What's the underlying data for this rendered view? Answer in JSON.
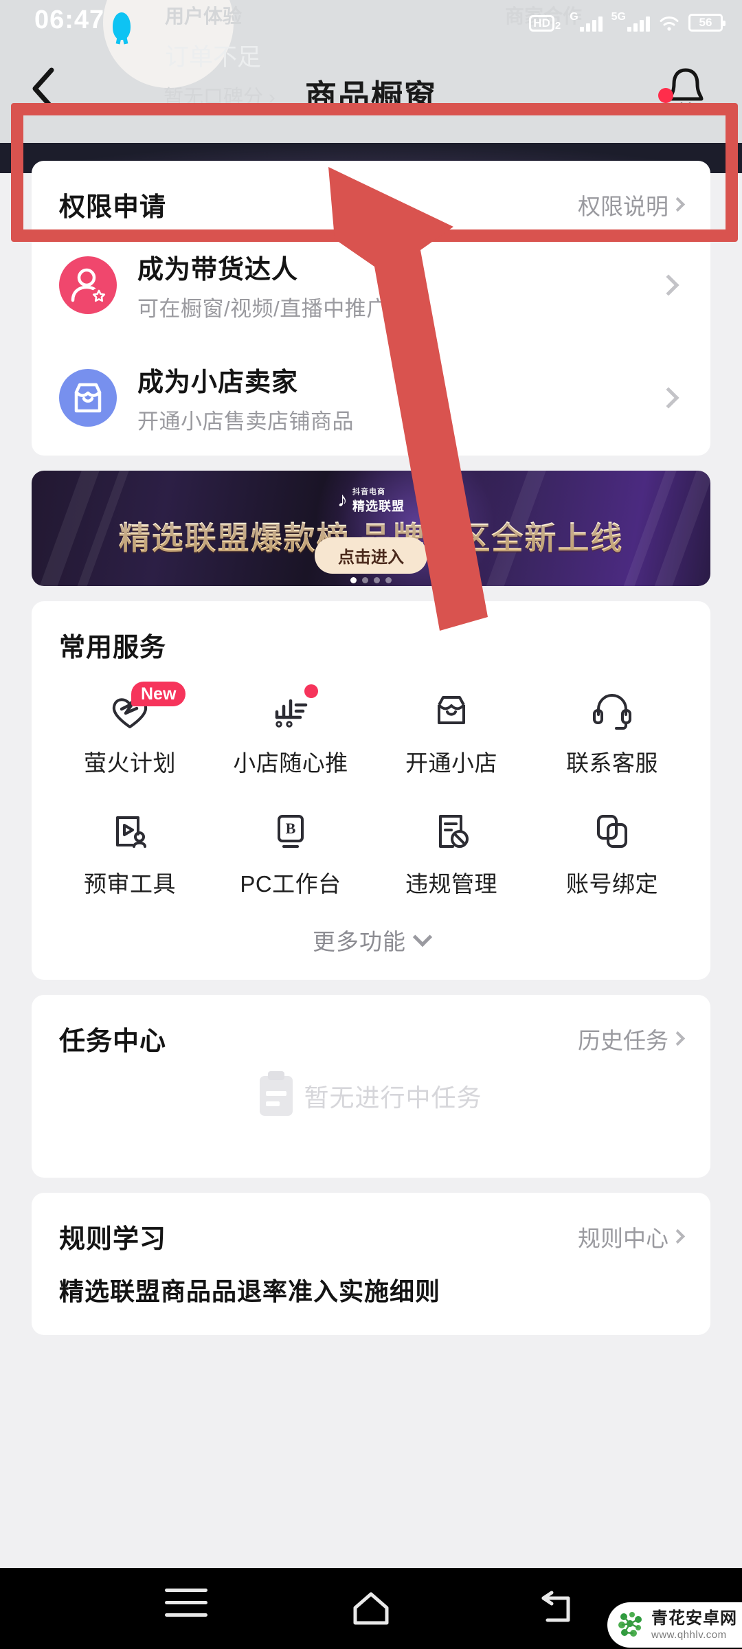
{
  "status_bar": {
    "time": "06:47",
    "hd_label": "HD",
    "hd_sub": "2",
    "net1_sup": "G",
    "net2_sup": "5G",
    "battery": "56",
    "icons": [
      "qq-icon",
      "hd-voice-icon",
      "signal-icon",
      "signal-5g-icon",
      "wifi-icon",
      "battery-icon"
    ]
  },
  "ghost_background": {
    "user_experience": "用户体验",
    "merchant_cooperation": "商家合作",
    "order_insufficient": "订单不足",
    "no_score": "暂无口碑分 ›"
  },
  "nav": {
    "title": "商品橱窗",
    "back_icon": "back-chevron-icon",
    "bell_icon": "bell-icon",
    "bell_has_dot": true
  },
  "permission_card": {
    "title": "权限申请",
    "link_label": "权限说明",
    "rows": [
      {
        "icon": "talent-person-star-icon",
        "icon_color": "#f0476d",
        "name": "成为带货达人",
        "desc": "可在橱窗/视频/直播中推广商品"
      },
      {
        "icon": "shop-store-icon",
        "icon_color": "#7790ee",
        "name": "成为小店卖家",
        "desc": "开通小店售卖店铺商品"
      }
    ]
  },
  "banner": {
    "logo_top": "抖音电商",
    "logo_bottom": "精选联盟",
    "title": "精选联盟爆款榜 品牌专区全新上线",
    "button": "点击进入",
    "dots": 4,
    "active_dot": 0
  },
  "services": {
    "title": "常用服务",
    "items": [
      {
        "label": "萤火计划",
        "icon": "firefly-heart-icon",
        "badge": "New"
      },
      {
        "label": "小店随心推",
        "icon": "promote-bars-icon",
        "dot": true
      },
      {
        "label": "开通小店",
        "icon": "open-shop-icon"
      },
      {
        "label": "联系客服",
        "icon": "headset-support-icon"
      },
      {
        "label": "预审工具",
        "icon": "preview-tool-icon"
      },
      {
        "label": "PC工作台",
        "icon": "pc-workbench-icon"
      },
      {
        "label": "违规管理",
        "icon": "violation-doc-icon"
      },
      {
        "label": "账号绑定",
        "icon": "account-link-icon"
      }
    ],
    "more_label": "更多功能",
    "more_icon": "chevron-down-icon"
  },
  "task_center": {
    "title": "任务中心",
    "link_label": "历史任务",
    "empty_text": "暂无进行中任务",
    "empty_icon": "clipboard-empty-icon"
  },
  "rules": {
    "title": "规则学习",
    "link_label": "规则中心",
    "items": [
      "精选联盟商品品退率准入实施细则"
    ]
  },
  "annotation": {
    "highlight_color": "#d9534f",
    "arrow_color": "#d9534f",
    "shape": "arrow-pointing-to-talent-row"
  },
  "system_nav": {
    "recent_icon": "recent-apps-icon",
    "home_icon": "home-icon",
    "back_icon": "system-back-icon"
  },
  "watermark": {
    "name": "青花安卓网",
    "url": "www.qhhlv.com",
    "logo_icon": "qinghua-logo-icon"
  }
}
